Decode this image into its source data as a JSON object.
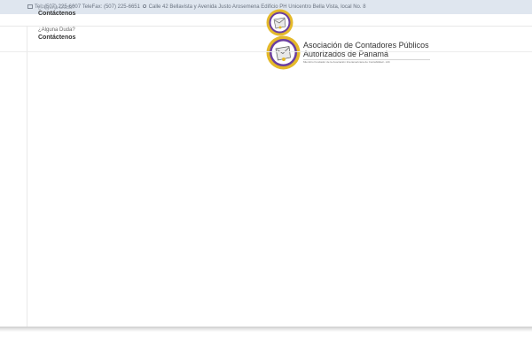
{
  "topbar": {
    "phone_label": "Tel: (507) 225-6607",
    "fax_label": "TeleFax: (507) 225-6651",
    "address": "Calle 42 Bellavista y Avenida Justo Arosemena Edificio PH Unicentro Bella Vista, local No. 8"
  },
  "overlap_header": {
    "question": "¿Alguna Duda?",
    "link": "Contáctenos"
  },
  "contact": {
    "question": "¿Alguna Duda?",
    "link": "Contáctenos"
  },
  "brand": {
    "line1": "Asociación de Contadores Públicos",
    "line2": "Autorizados de Panamá",
    "subtitle": "Miembro Fundador de la Asociación Interamericana de Contabilidad - AIC"
  },
  "colors": {
    "topbar_bg": "#dfe6ef",
    "logo_ring": "#e4b92a",
    "logo_inner": "#6b3fa0"
  }
}
